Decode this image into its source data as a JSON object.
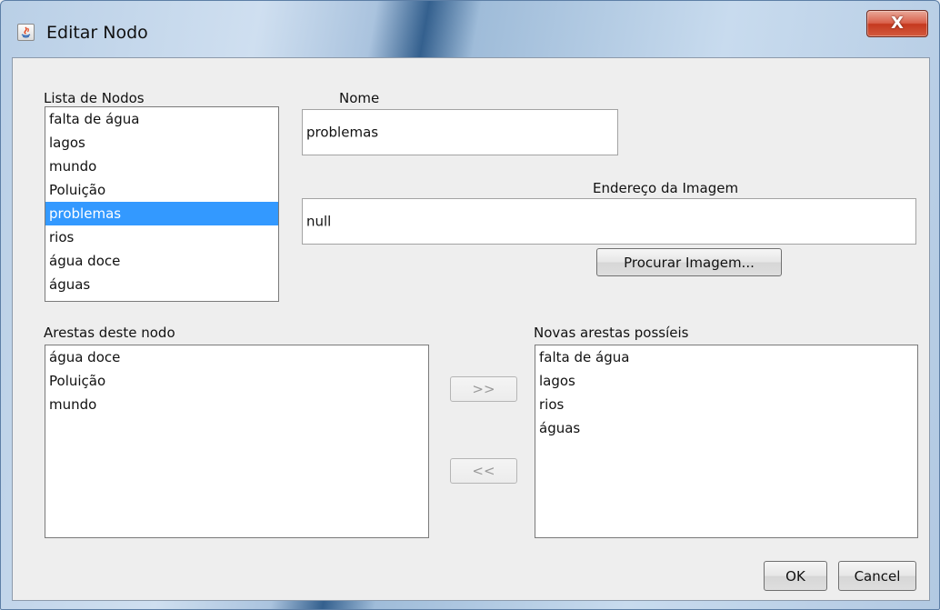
{
  "window": {
    "title": "Editar Nodo",
    "close_glyph": "X"
  },
  "node_list": {
    "label": "Lista de Nodos",
    "items": [
      "falta de água",
      "lagos",
      "mundo",
      "Poluição",
      "problemas",
      "rios",
      "água doce",
      "águas"
    ],
    "selected": "problemas"
  },
  "name_field": {
    "label": "Nome",
    "value": "problemas"
  },
  "image_field": {
    "label": "Endereço da Imagem",
    "value": "null"
  },
  "browse_button": {
    "label": "Procurar Imagem..."
  },
  "current_edges": {
    "label": "Arestas deste nodo",
    "items": [
      "água doce",
      "Poluição",
      "mundo"
    ]
  },
  "possible_edges": {
    "label": "Novas arestas possíeis",
    "items": [
      "falta de água",
      "lagos",
      "rios",
      "águas"
    ]
  },
  "transfer": {
    "add_label": ">>",
    "remove_label": "<<"
  },
  "footer": {
    "ok_label": "OK",
    "cancel_label": "Cancel"
  },
  "colors": {
    "selection": "#3399ff",
    "close_button": "#c5391f"
  }
}
